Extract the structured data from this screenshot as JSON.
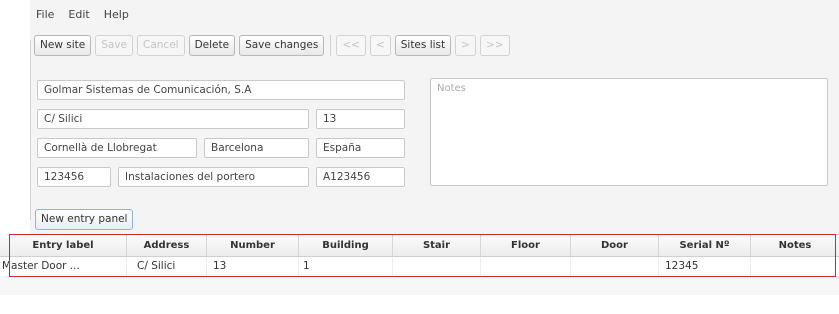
{
  "menu": [
    "File",
    "Edit",
    "Help"
  ],
  "toolbar": {
    "new_site": "New site",
    "save": "Save",
    "cancel": "Cancel",
    "delete": "Delete",
    "save_changes": "Save changes",
    "first": "<<",
    "prev": "<",
    "sites_list": "Sites list",
    "next": ">",
    "last": ">>"
  },
  "form": {
    "company": "Golmar Sistemas de Comunicación, S.A",
    "street": "C/ Silici",
    "street_number": "13",
    "city": "Cornellà de Llobregat",
    "province": "Barcelona",
    "country": "España",
    "postal_code": "123456",
    "description": "Instalaciones del portero",
    "code": "A123456",
    "notes_placeholder": "Notes"
  },
  "new_entry_panel": "New entry panel",
  "table": {
    "headers": {
      "entry_label": "Entry label",
      "address": "Address",
      "number": "Number",
      "building": "Building",
      "stair": "Stair",
      "floor": "Floor",
      "door": "Door",
      "serial": "Serial Nº",
      "notes": "Notes"
    },
    "rows": [
      {
        "entry_label": "Master Door ...",
        "address": "C/ Silici",
        "number": "13",
        "building": "1",
        "stair": "",
        "floor": "",
        "door": "",
        "serial": "12345",
        "notes": ""
      }
    ]
  },
  "colors": {
    "highlight": "#cc2a2a",
    "panel_border": "#8fb4d9"
  }
}
